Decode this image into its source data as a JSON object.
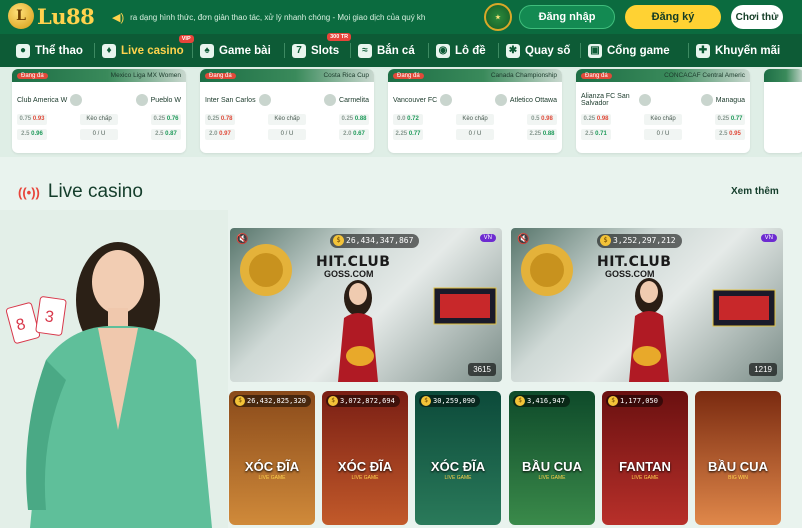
{
  "header": {
    "logo_text": "Lu88",
    "marquee_text": "ra dạng hình thức, đơn giản thao tác, xử lý nhanh chóng - Mọi giao dịch của quý kh",
    "login_label": "Đăng nhập",
    "register_label": "Đăng ký",
    "demo_label": "Chơi thử"
  },
  "nav": {
    "items": [
      {
        "label": "Thể thao",
        "icon": "ball-icon"
      },
      {
        "label": "Live casino",
        "icon": "casino-icon",
        "badge": "VIP"
      },
      {
        "label": "Game bài",
        "icon": "cards-icon"
      },
      {
        "label": "Slots",
        "icon": "slots-icon",
        "badge": "300 TR"
      },
      {
        "label": "Bắn cá",
        "icon": "fish-icon"
      },
      {
        "label": "Lô đề",
        "icon": "lottery-icon"
      },
      {
        "label": "Quay số",
        "icon": "wheel-icon"
      },
      {
        "label": "Cổng game",
        "icon": "gamepad-icon"
      },
      {
        "label": "Khuyến mãi",
        "icon": "gift-icon"
      }
    ]
  },
  "matches": [
    {
      "status": "Đang đá",
      "league": "Mexico Liga MX Women",
      "home": "Club America W",
      "away": "Pueblo W",
      "odds": [
        [
          "0.75",
          "0.93",
          "Kèo chấp",
          "0.25",
          "0.76"
        ],
        [
          "2.5",
          "0.96",
          "0 / U",
          "2.5",
          "0.87"
        ]
      ]
    },
    {
      "status": "Đang đá",
      "league": "Costa Rica Cup",
      "home": "Inter San Carlos",
      "away": "Carmelita",
      "odds": [
        [
          "0.25",
          "0.78",
          "Kèo chấp",
          "0.25",
          "0.88"
        ],
        [
          "2.0",
          "0.97",
          "0 / U",
          "2.0",
          "0.67"
        ]
      ]
    },
    {
      "status": "Đang đá",
      "league": "Canada Championship",
      "home": "Vancouver FC",
      "away": "Atletico Ottawa",
      "odds": [
        [
          "0.0",
          "0.72",
          "Kèo chấp",
          "0.5",
          "0.98"
        ],
        [
          "2.25",
          "0.77",
          "0 / U",
          "2.25",
          "0.88"
        ]
      ]
    },
    {
      "status": "Đang đá",
      "league": "CONCACAF Central Americ",
      "home": "Alianza FC San Salvador",
      "away": "Managua",
      "odds": [
        [
          "0.25",
          "0.98",
          "Kèo chấp",
          "0.25",
          "0.77"
        ],
        [
          "2.5",
          "0.71",
          "0 / U",
          "2.5",
          "0.95"
        ]
      ]
    }
  ],
  "live_section": {
    "title": "Live casino",
    "see_more": "Xem thêm"
  },
  "streams": [
    {
      "jackpot": "26,434,347,867",
      "brand": "HIT.CLUB",
      "brand2": "GOSS.COM",
      "flag": "VN",
      "viewers": "3615"
    },
    {
      "jackpot": "3,252,297,212",
      "brand": "HIT.CLUB",
      "brand2": "GOSS.COM",
      "flag": "VN",
      "viewers": "1219"
    }
  ],
  "games": [
    {
      "jackpot": "26,432,825,320",
      "name": "XÓC ĐĨA",
      "sub": "LIVE GAME",
      "color1": "#8a4a1a",
      "color2": "#d08a3a"
    },
    {
      "jackpot": "3,072,872,694",
      "name": "XÓC ĐĨA",
      "sub": "LIVE GAME",
      "color1": "#7a1e14",
      "color2": "#c25a2a"
    },
    {
      "jackpot": "30,259,090",
      "name": "XÓC ĐĨA",
      "sub": "LIVE GAME",
      "color1": "#0c4a3a",
      "color2": "#2a7a5a"
    },
    {
      "jackpot": "3,416,947",
      "name": "BẦU CUA",
      "sub": "LIVE GAME",
      "color1": "#0e4a2a",
      "color2": "#3a8a4a"
    },
    {
      "jackpot": "1,177,050",
      "name": "FANTAN",
      "sub": "LIVE GAME",
      "color1": "#6a1010",
      "color2": "#b8302a"
    },
    {
      "jackpot": "",
      "name": "BẦU CUA",
      "sub": "BIG WIN",
      "color1": "#7a2a10",
      "color2": "#e0884a"
    }
  ]
}
